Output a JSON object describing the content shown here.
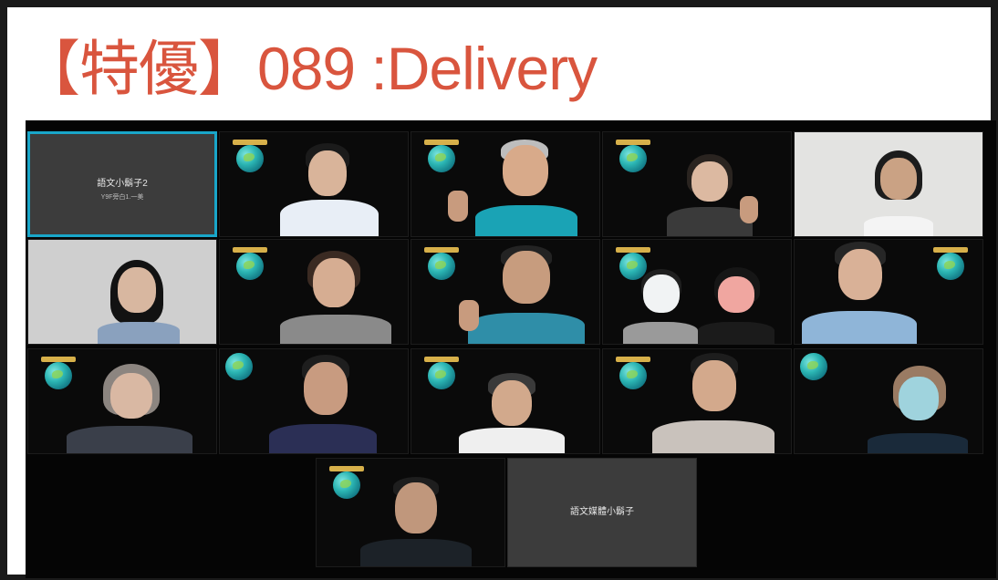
{
  "title": "【特優】089 :Delivery",
  "colors": {
    "title": "#d9553e",
    "active_border": "#19a6c9"
  },
  "participants": [
    {
      "id": "p1",
      "kind": "placeholder",
      "name": "語文小鬍子2",
      "subtitle": "Y9F旁白1.一美"
    },
    {
      "id": "p2",
      "kind": "video"
    },
    {
      "id": "p3",
      "kind": "video"
    },
    {
      "id": "p4",
      "kind": "video"
    },
    {
      "id": "p5",
      "kind": "video"
    },
    {
      "id": "p6",
      "kind": "video"
    },
    {
      "id": "p7",
      "kind": "video"
    },
    {
      "id": "p8",
      "kind": "video"
    },
    {
      "id": "p9",
      "kind": "video"
    },
    {
      "id": "p10",
      "kind": "video"
    },
    {
      "id": "p11",
      "kind": "video"
    },
    {
      "id": "p12",
      "kind": "video"
    },
    {
      "id": "p13",
      "kind": "video"
    },
    {
      "id": "p14",
      "kind": "video"
    },
    {
      "id": "p15",
      "kind": "video"
    },
    {
      "id": "p16",
      "kind": "video"
    },
    {
      "id": "p17",
      "kind": "placeholder",
      "name": "語文媒體小鬍子"
    }
  ]
}
